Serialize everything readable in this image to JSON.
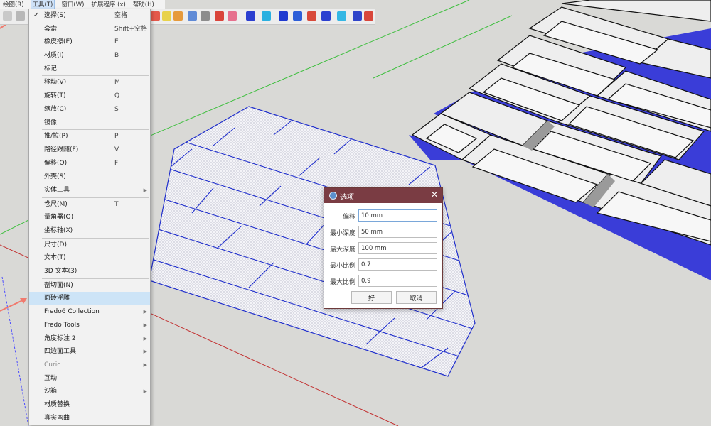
{
  "menubar": {
    "items": [
      {
        "label": "绘图(R)"
      },
      {
        "label": "工具(T)",
        "active": true
      },
      {
        "label": "窗口(W)"
      },
      {
        "label": "扩展程序 (x)"
      },
      {
        "label": "帮助(H)"
      }
    ]
  },
  "tools_menu": {
    "groups": [
      [
        {
          "label": "选择(S)",
          "shortcut": "空格",
          "checked": true
        },
        {
          "label": "套索",
          "shortcut": "Shift+空格"
        },
        {
          "label": "橡皮擦(E)",
          "shortcut": "E"
        },
        {
          "label": "材质(I)",
          "shortcut": "B"
        },
        {
          "label": "标记"
        }
      ],
      [
        {
          "label": "移动(V)",
          "shortcut": "M"
        },
        {
          "label": "旋转(T)",
          "shortcut": "Q"
        },
        {
          "label": "缩放(C)",
          "shortcut": "S"
        },
        {
          "label": "镜像"
        }
      ],
      [
        {
          "label": "推/拉(P)",
          "shortcut": "P"
        },
        {
          "label": "路径跟随(F)",
          "shortcut": "V"
        },
        {
          "label": "偏移(O)",
          "shortcut": "F"
        }
      ],
      [
        {
          "label": "外壳(S)"
        },
        {
          "label": "实体工具",
          "submenu": true
        }
      ],
      [
        {
          "label": "卷尺(M)",
          "shortcut": "T"
        },
        {
          "label": "量角器(O)"
        },
        {
          "label": "坐标轴(X)"
        }
      ],
      [
        {
          "label": "尺寸(D)"
        },
        {
          "label": "文本(T)"
        },
        {
          "label": "3D 文本(3)"
        }
      ],
      [
        {
          "label": "剖切面(N)"
        },
        {
          "label": "面砖浮雕",
          "highlighted": true
        },
        {
          "label": "Fredo6 Collection",
          "submenu": true
        },
        {
          "label": "Fredo Tools",
          "submenu": true
        },
        {
          "label": "角度标注 2",
          "submenu": true
        },
        {
          "label": "四边面工具",
          "submenu": true
        },
        {
          "label": "Curic",
          "submenu": true,
          "disabled": true
        },
        {
          "label": "互动"
        },
        {
          "label": "沙箱",
          "submenu": true
        },
        {
          "label": "材质替换"
        },
        {
          "label": "真实弯曲"
        }
      ]
    ]
  },
  "dialog": {
    "title": "选项",
    "fields": [
      {
        "label": "偏移",
        "value": "10 mm",
        "focused": true
      },
      {
        "label": "最小深度",
        "value": "50 mm"
      },
      {
        "label": "最大深度",
        "value": "100 mm"
      },
      {
        "label": "最小比例",
        "value": "0.7"
      },
      {
        "label": "最大比例",
        "value": "0.9"
      }
    ],
    "ok_label": "好",
    "cancel_label": "取消"
  },
  "colors": {
    "background": "#d9d9d6",
    "dialog_titlebar": "#7a3c43",
    "edge_blue": "#1f2ecc",
    "menu_highlight": "#cde4f7",
    "annotation_arrow": "#f07a6e"
  },
  "toolbar_icons": [
    "select-icon",
    "eraser-icon",
    "paint-icon",
    "move-icon",
    "rotate-icon",
    "scale-icon",
    "pushpull-icon",
    "offset-icon",
    "tape-icon",
    "text-icon",
    "axes-icon",
    "section-icon"
  ]
}
